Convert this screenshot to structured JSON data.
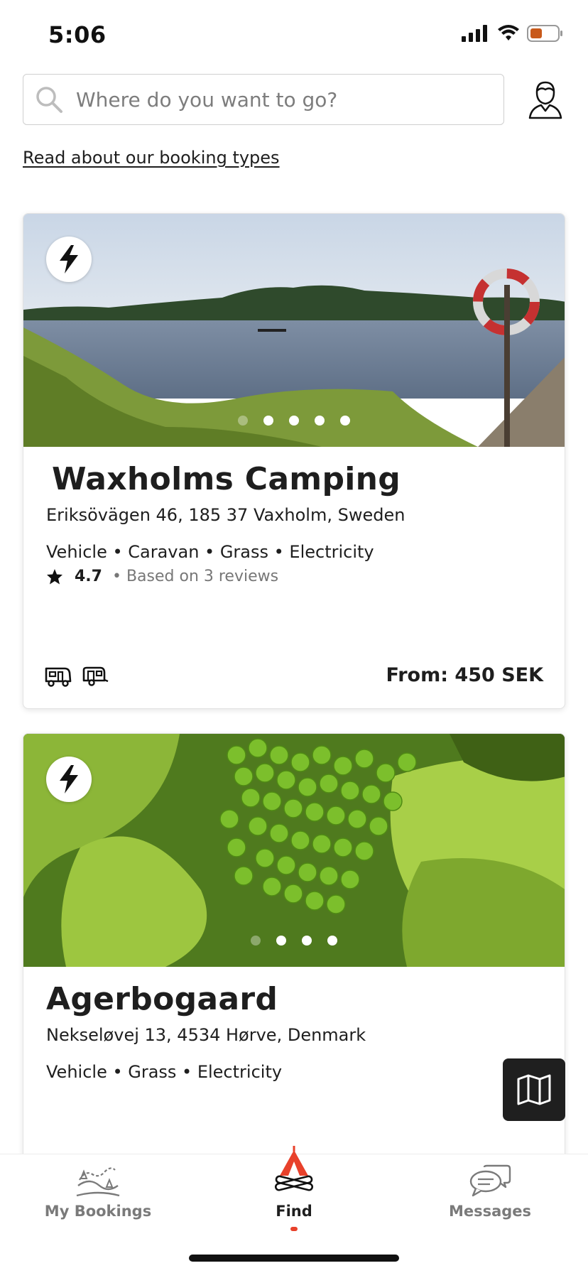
{
  "status_bar": {
    "time": "5:06"
  },
  "search": {
    "placeholder": "Where do you want to go?"
  },
  "booking_types_link": "Read about our booking types",
  "listings": [
    {
      "name": "Waxholms Camping",
      "address": "Eriksövägen 46, 185 37 Vaxholm, Sweden",
      "features": "Vehicle • Caravan • Grass • Electricity",
      "rating": "4.7",
      "reviews": "• Based on 3 reviews",
      "price": "From: 450 SEK",
      "photo_dots": 5,
      "active_dot": 1
    },
    {
      "name": "Agerbogaard",
      "address": "Nekseløvej 13, 4534 Hørve, Denmark",
      "features": "Vehicle • Grass • Electricity",
      "photo_dots": 4,
      "active_dot": 1
    }
  ],
  "tabs": [
    {
      "label": "My Bookings",
      "icon": "map-route-icon",
      "active": false
    },
    {
      "label": "Find",
      "icon": "campfire-tent-icon",
      "active": true
    },
    {
      "label": "Messages",
      "icon": "chat-bubbles-icon",
      "active": false
    }
  ],
  "colors": {
    "accent": "#e8412b",
    "text": "#1e1e1e",
    "muted": "#7a7a7a"
  }
}
